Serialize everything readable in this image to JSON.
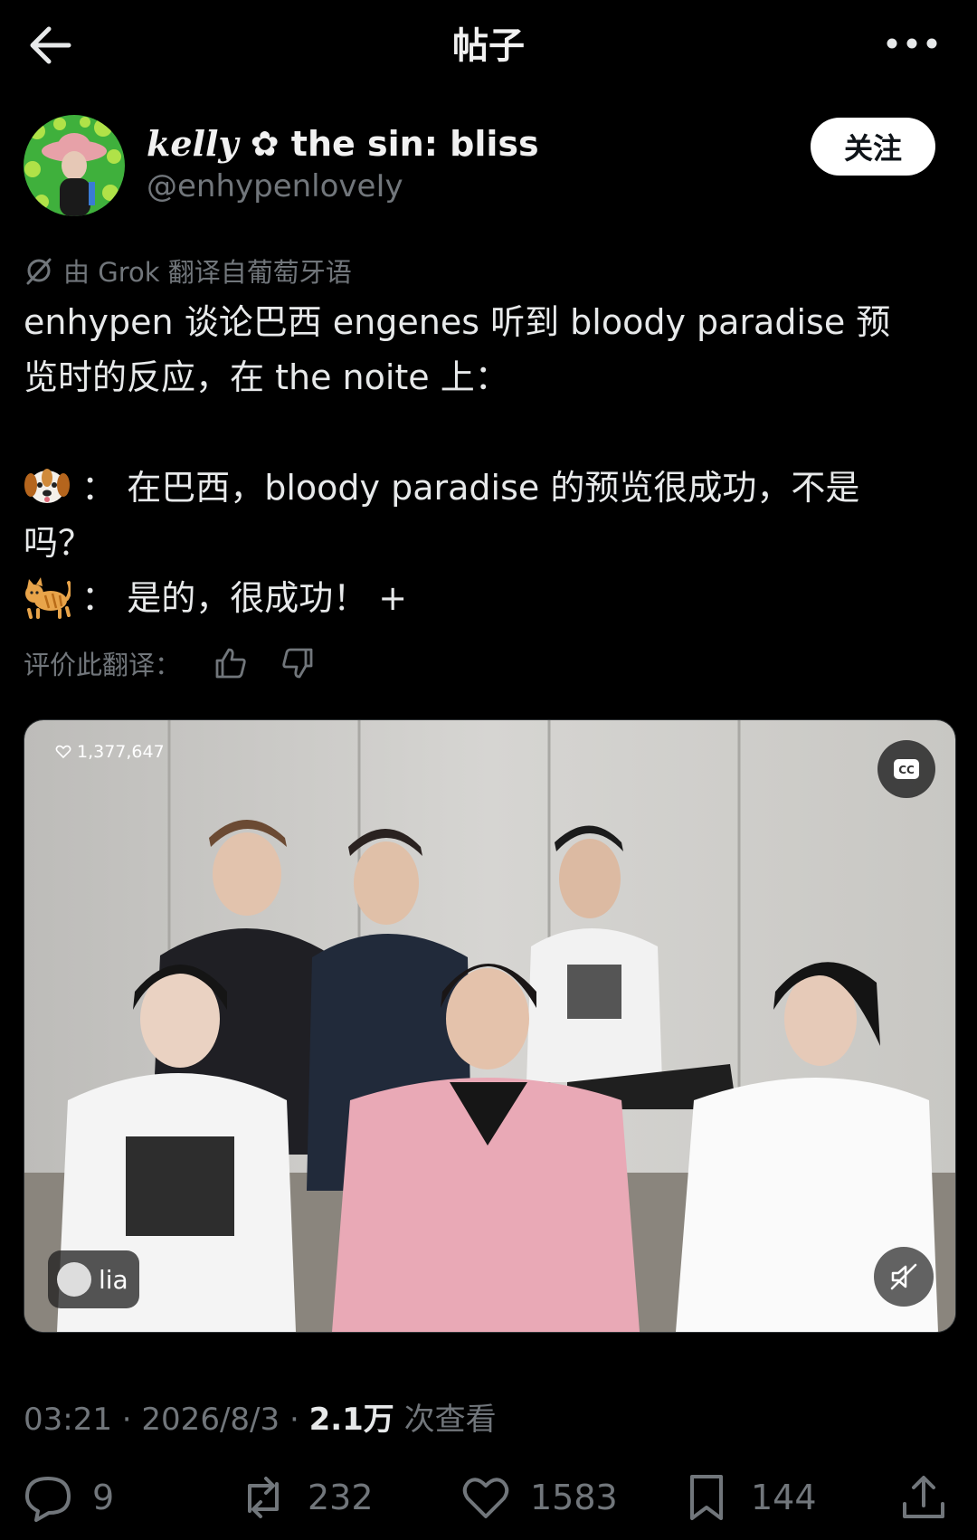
{
  "header": {
    "title": "帖子"
  },
  "post": {
    "author": {
      "display_name_italic": "kelly",
      "display_name_rest": "✿ the sin: bliss",
      "handle": "@enhypenloveIy"
    },
    "follow_label": "关注",
    "translation_note": "由 Grok 翻译自葡萄牙语",
    "text_lines": [
      "enhypen 谈论巴西 engenes 听到 bloody paradise 预",
      "览时的反应，在 the noite 上："
    ],
    "dialogue": {
      "line1_prefix": "：",
      "line1": "在巴西，bloody paradise 的预览很成功，不是",
      "line1_wrap": "吗？",
      "line2_prefix": "：",
      "line2": "是的，很成功！ +"
    },
    "rate_label": "评价此翻译：",
    "media": {
      "likes": "1,377,647",
      "user_chip": "lia"
    },
    "meta": {
      "time": "03:21",
      "date": "2026/8/3",
      "views": "2.1万",
      "views_label": "次查看"
    },
    "stats": {
      "replies": "9",
      "reposts": "232",
      "likes": "1583",
      "bookmarks": "144"
    }
  },
  "icons": {
    "back": "arrow-left-icon",
    "more": "more-horizontal-icon",
    "reply": "reply-icon",
    "repost": "repost-icon",
    "like": "heart-icon",
    "bookmark": "bookmark-icon",
    "share": "share-icon"
  }
}
